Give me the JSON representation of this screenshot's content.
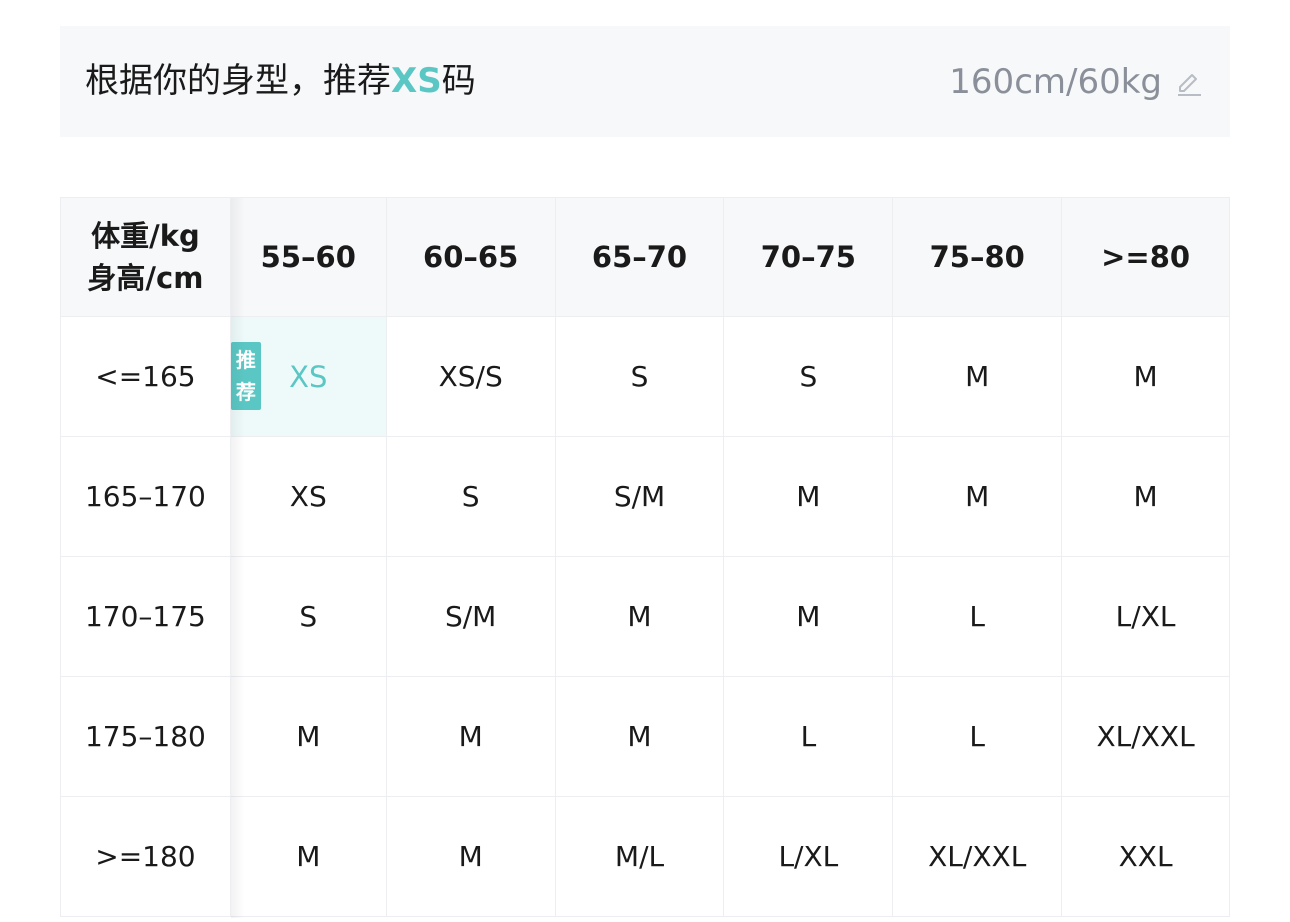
{
  "banner": {
    "prefix": "根据你的身型，推荐",
    "size": "XS",
    "suffix": "码",
    "measurement": "160cm/60kg",
    "edit_icon": "pencil-edit-icon"
  },
  "table": {
    "corner_line1": "体重/kg",
    "corner_line2": "身高/cm",
    "weight_headers": [
      "55–60",
      "60–65",
      "65–70",
      "70–75",
      "75–80",
      ">=80"
    ],
    "rows": [
      {
        "height": "<=165",
        "sizes": [
          "XS",
          "XS/S",
          "S",
          "S",
          "M",
          "M"
        ]
      },
      {
        "height": "165–170",
        "sizes": [
          "XS",
          "S",
          "S/M",
          "M",
          "M",
          "M"
        ]
      },
      {
        "height": "170–175",
        "sizes": [
          "S",
          "S/M",
          "M",
          "M",
          "L",
          "L/XL"
        ]
      },
      {
        "height": "175–180",
        "sizes": [
          "M",
          "M",
          "M",
          "L",
          "L",
          "XL/XXL"
        ]
      },
      {
        "height": ">=180",
        "sizes": [
          "M",
          "M",
          "M/L",
          "L/XL",
          "XL/XXL",
          "XXL"
        ]
      }
    ],
    "recommend_badge_line1": "推",
    "recommend_badge_line2": "荐"
  },
  "colors": {
    "accent": "#5bc7c4",
    "banner_bg": "#f7f8fa",
    "highlight_bg": "#eefaf9",
    "muted_text": "#8a8f99"
  }
}
